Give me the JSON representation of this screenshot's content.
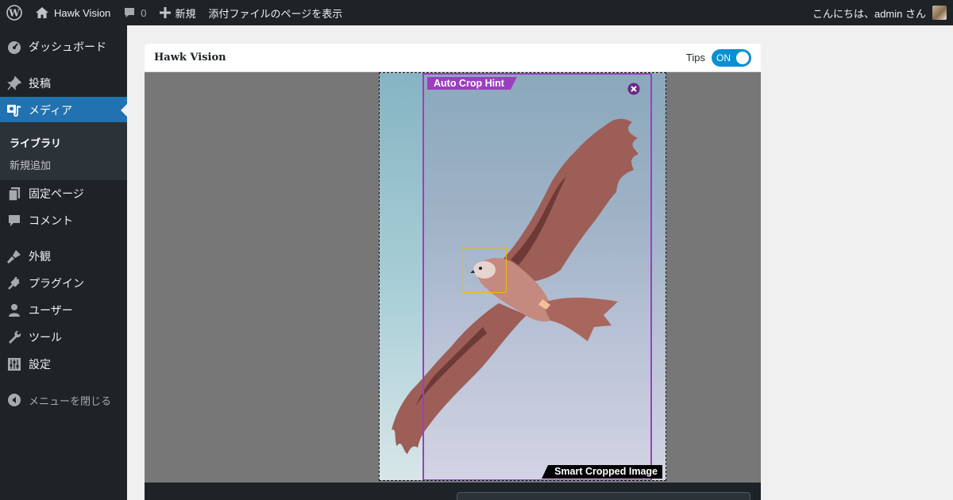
{
  "adminbar": {
    "site_name": "Hawk Vision",
    "comments_count": "0",
    "new_label": "新規",
    "view_attachment": "添付ファイルのページを表示",
    "greeting": "こんにちは、admin さん",
    "icons": [
      "wordpress-logo-icon",
      "home-icon",
      "comment-bubble-icon",
      "plus-icon",
      "avatar"
    ]
  },
  "sidebar": {
    "items": [
      {
        "label": "ダッシュボード",
        "icon": "dashboard-icon"
      },
      {
        "label": "投稿",
        "icon": "pin-icon"
      },
      {
        "label": "メディア",
        "icon": "media-icon",
        "active": true
      },
      {
        "label": "固定ページ",
        "icon": "pages-icon"
      },
      {
        "label": "コメント",
        "icon": "comment-icon"
      },
      {
        "label": "外観",
        "icon": "appearance-icon"
      },
      {
        "label": "プラグイン",
        "icon": "plugin-icon"
      },
      {
        "label": "ユーザー",
        "icon": "user-icon"
      },
      {
        "label": "ツール",
        "icon": "wrench-icon"
      },
      {
        "label": "設定",
        "icon": "settings-icon"
      }
    ],
    "submenu": [
      "ライブラリ",
      "新規追加"
    ],
    "collapse_label": "メニューを閉じる"
  },
  "panel": {
    "title": "Hawk Vision",
    "tips_label": "Tips",
    "toggle_label": "ON",
    "auto_crop_label": "Auto Crop Hint",
    "smart_crop_label": "Smart Cropped Image"
  },
  "colors": {
    "admin_bg": "#1d2327",
    "active_menu": "#2271b1",
    "toggle_on": "#0a8fd1",
    "crop_hint": "#9b3fbf",
    "focus_box": "#f2b705"
  }
}
